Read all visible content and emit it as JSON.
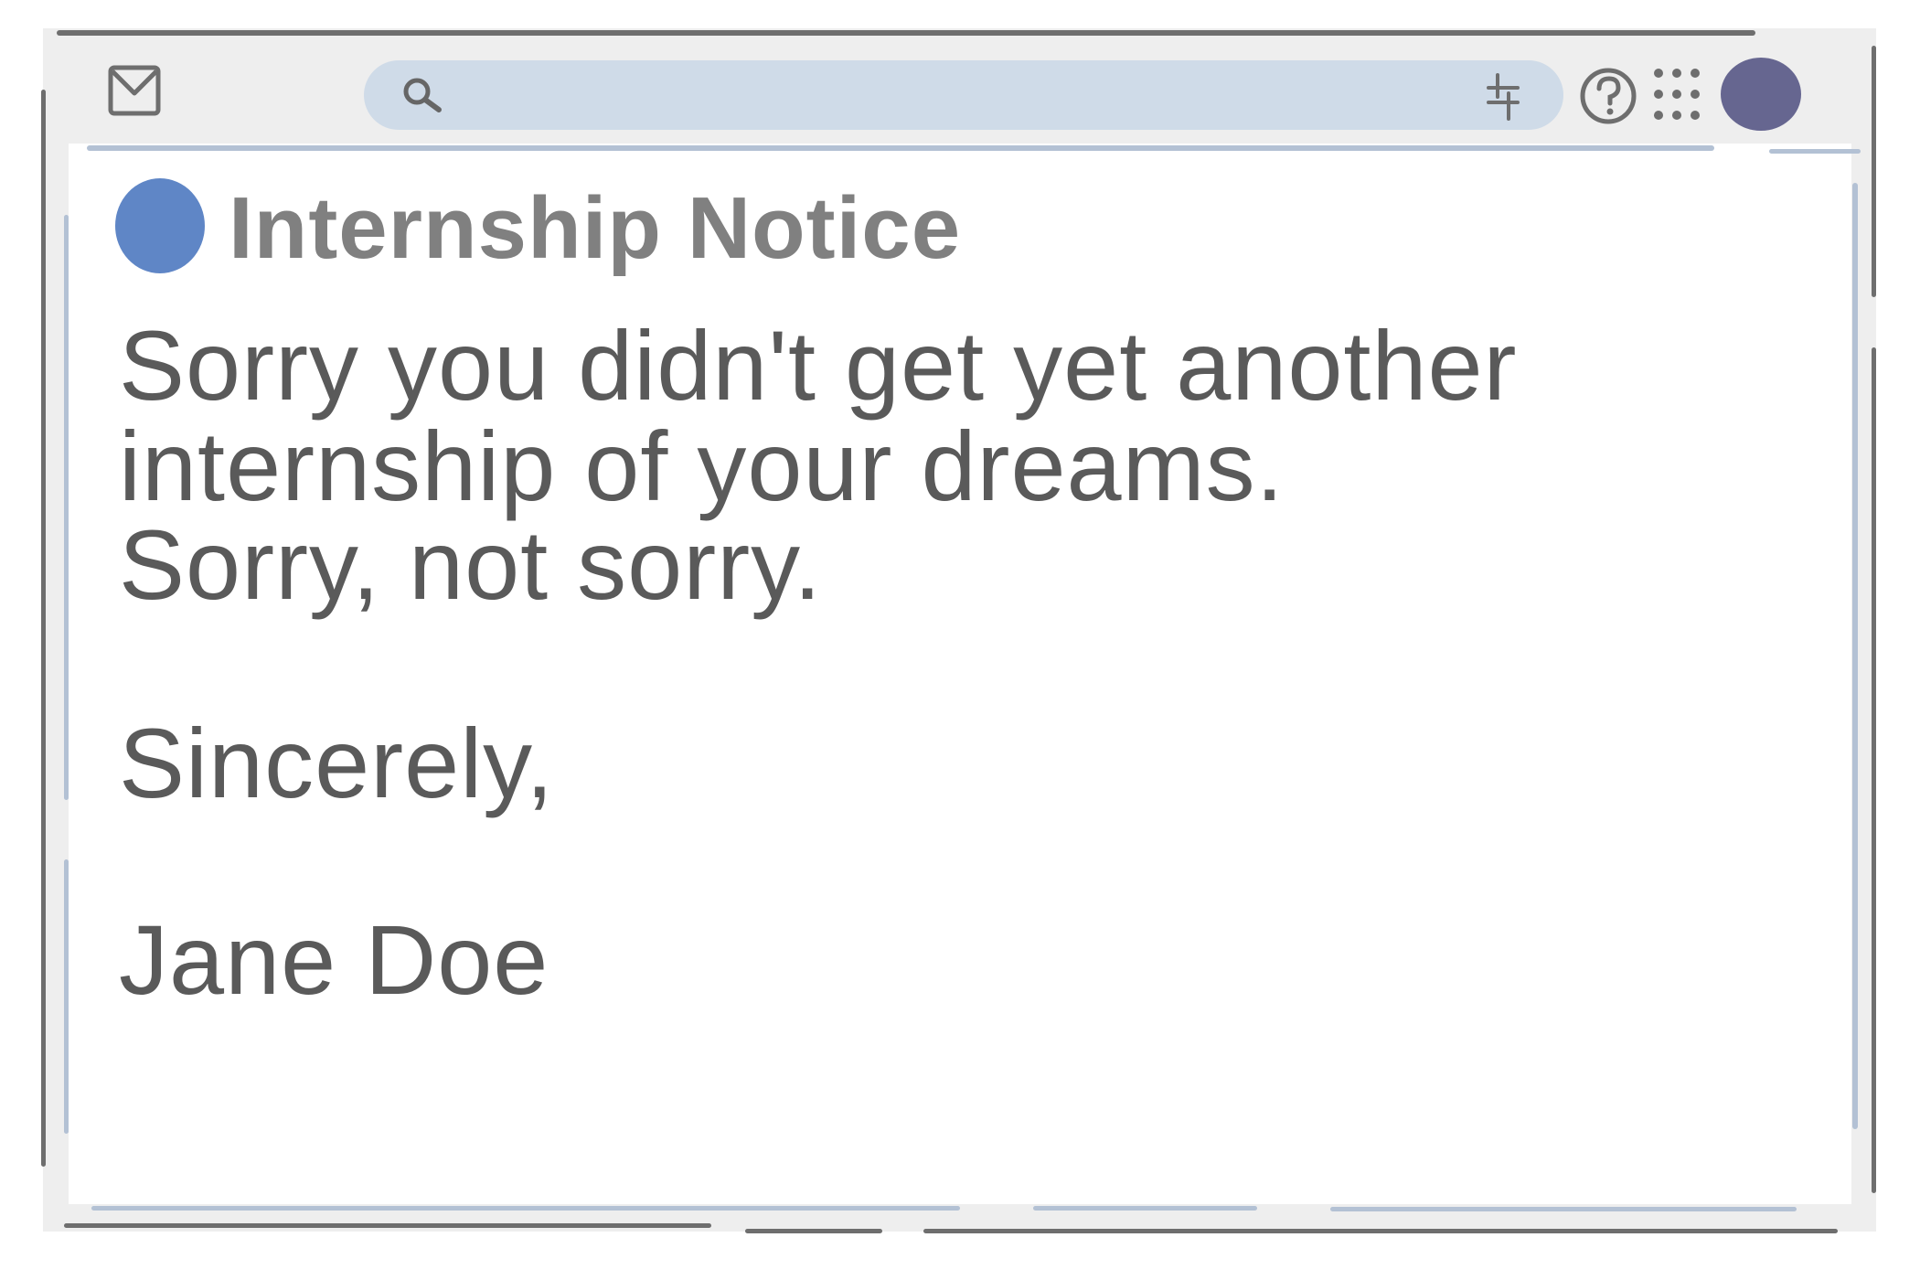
{
  "toolbar": {
    "mail_icon": "mail-icon",
    "search": {
      "placeholder": "",
      "search_icon": "search-icon",
      "filter_icon": "filter-sliders-icon"
    },
    "help_icon": "help-icon",
    "apps_icon": "apps-grid-icon",
    "avatar_color": "#666690",
    "search_bar_color": "#cfdbe8"
  },
  "email": {
    "unread_color": "#5f86c6",
    "subject": "Internship Notice",
    "body": {
      "line1": "Sorry you didn't get yet another",
      "line2": "internship of your dreams.",
      "line3": "Sorry, not sorry.",
      "closing": "Sincerely,",
      "signature": "Jane Doe"
    }
  }
}
